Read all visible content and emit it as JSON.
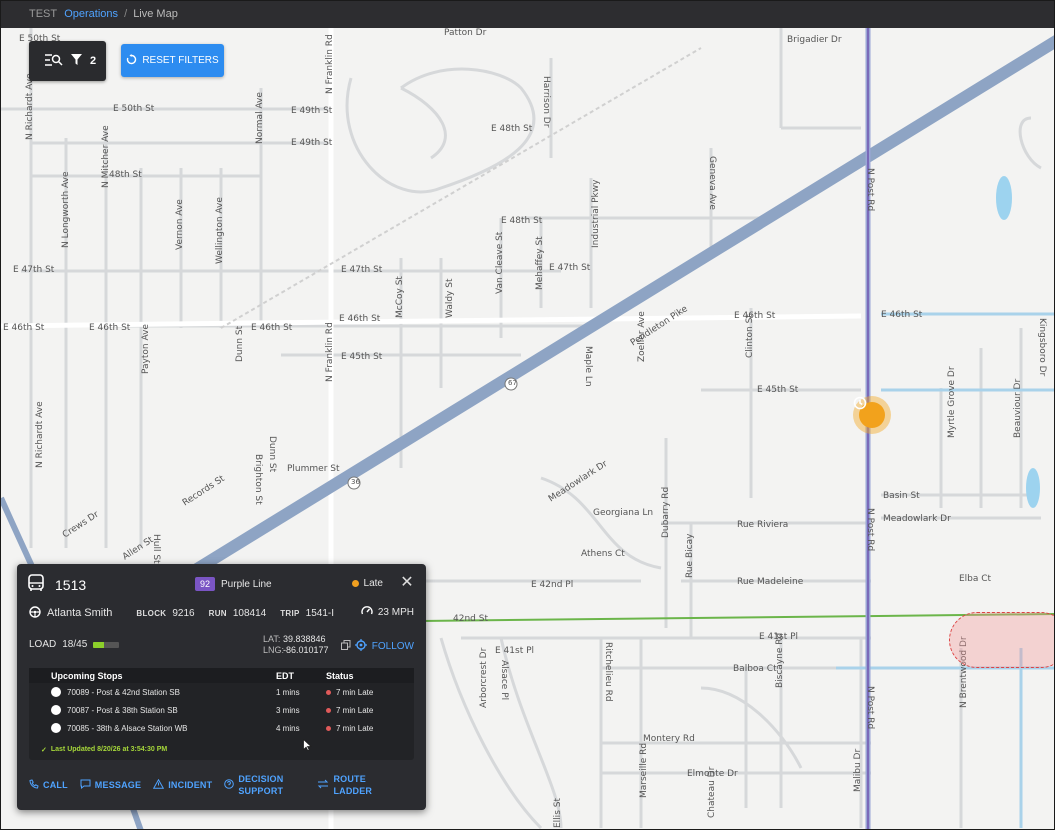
{
  "breadcrumb": {
    "env": "TEST",
    "section": "Operations",
    "separator": "/",
    "page": "Live Map"
  },
  "controls": {
    "filter_count": "2",
    "reset_label": "RESET FILTERS"
  },
  "map": {
    "labels": [
      "E 50th St",
      "Patton Dr",
      "Brigadier Dr",
      "E 50th St",
      "E 49th St",
      "E 48th St",
      "E 49th St",
      "48th St",
      "E 48th St",
      "E 47th St",
      "E 47th St",
      "E 47th St",
      "E 46th St",
      "E 46th St",
      "E 46th St",
      "E 46th St",
      "E 46th St",
      "E 46th St",
      "E 45th St",
      "E 45th St",
      "Basin St",
      "Meadowlark Dr",
      "Rue Riviera",
      "Rue Madeleine",
      "E 42nd Pl",
      "42nd St",
      "E 41st Pl",
      "E 41st Pl",
      "Balboa Ct",
      "Montery Rd",
      "Elmonte Dr",
      "Pendleton Pike",
      "Records St",
      "Plummer St",
      "Crews Dr",
      "Allen St",
      "Athens Ct",
      "Elba Ct",
      "Georgiana Ln",
      "Meadowlark Dr",
      "N Richardt Ave",
      "N Mitcher Ave",
      "N Longworth Ave",
      "Vernon Ave",
      "Wellington Ave",
      "Normal Ave",
      "N Franklin Rd",
      "N Franklin Rd",
      "McCoy St",
      "Waldy St",
      "Van Cleave St",
      "Mehaffey St",
      "Industrial Pkwy",
      "Geneva Ave",
      "Payton Ave",
      "Dunn St",
      "Maple Ln",
      "Clinton St",
      "Zoeller Ave",
      "N Post Rd",
      "N Post Rd",
      "N Post Rd",
      "Dubarry Rd",
      "Rue Bicay",
      "Biscayne Rd",
      "Arborcrest Dr",
      "Alsace Pl",
      "Marseille Rd",
      "Chateau Dr",
      "Malibu Dr",
      "N Brentwood Dr",
      "Myrtle Grove Dr",
      "Kingsboro Dr",
      "Harrison Dr",
      "Brighton St",
      "Dunn St",
      "Hull St",
      "N Richardt Ave",
      "Ellis St",
      "67",
      "36",
      "Ritchelieu Rd",
      "Beauviour Dr"
    ]
  },
  "vehicle": {
    "id": "1513",
    "route_number": "92",
    "route_name": "Purple Line",
    "status": "Late",
    "driver": "Atlanta Smith",
    "block_label": "BLOCK",
    "block": "9216",
    "run_label": "RUN",
    "run": "108414",
    "trip_label": "TRIP",
    "trip": "1541-I",
    "speed": "23 MPH",
    "load_label": "LOAD",
    "load": "18/45",
    "load_fraction": 0.4,
    "lat_label": "LAT:",
    "lat": "39.838846",
    "lng_label": "LNG:",
    "lng": "-86.010177",
    "follow_label": "FOLLOW"
  },
  "stops": {
    "headers": {
      "stop": "Upcoming Stops",
      "edt": "EDT",
      "status": "Status"
    },
    "rows": [
      {
        "name": "70089 - Post & 42nd Station SB",
        "edt": "1 mins",
        "status": "7 min Late"
      },
      {
        "name": "70087 - Post & 38th Station SB",
        "edt": "3 mins",
        "status": "7 min Late"
      },
      {
        "name": "70085 - 38th & Alsace Station WB",
        "edt": "4 mins",
        "status": "7 min Late"
      }
    ],
    "last_updated": "Last Updated 8/20/26 at 3:54:30 PM"
  },
  "actions": {
    "call": "CALL",
    "message": "MESSAGE",
    "incident": "INCIDENT",
    "decision_1": "DECISION",
    "decision_2": "SUPPORT",
    "route_1": "ROUTE",
    "route_2": "LADDER"
  },
  "colors": {
    "accent": "#2d8cf0",
    "route_badge": "#7a55c4",
    "late": "#f0a020",
    "status_late": "#e05a5a",
    "updated": "#a5d63a"
  }
}
